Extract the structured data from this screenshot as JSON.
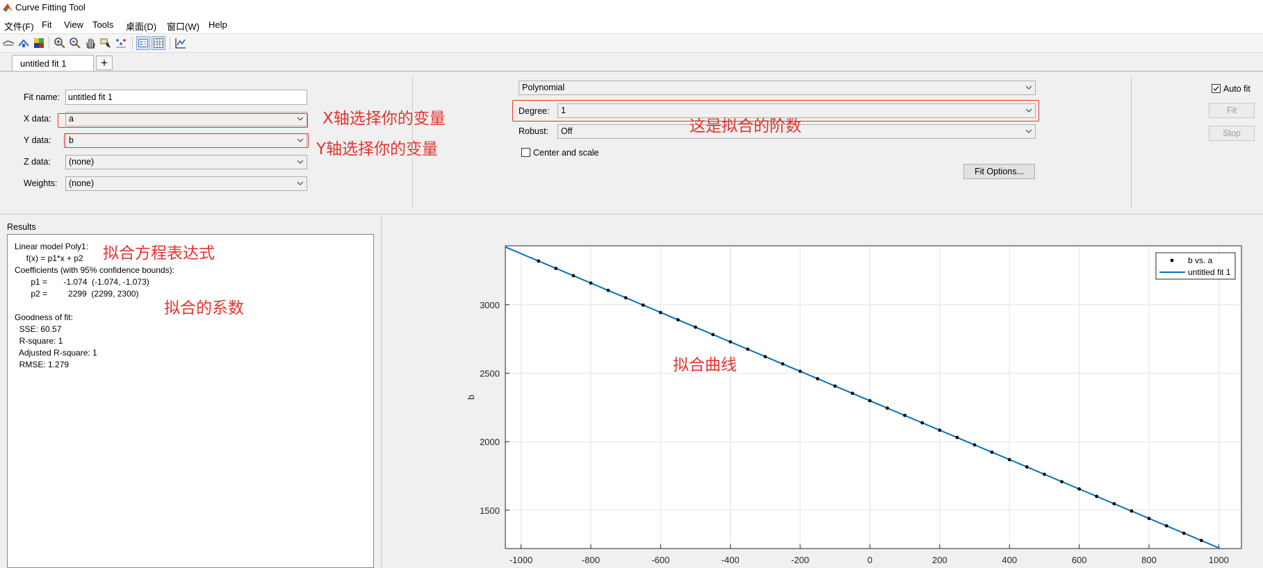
{
  "window": {
    "title": "Curve Fitting Tool"
  },
  "menu": [
    "文件(F)",
    "Fit",
    "View",
    "Tools",
    "桌面(D)",
    "窗口(W)",
    "Help"
  ],
  "tabs": {
    "active": "untitled fit 1",
    "add": "+"
  },
  "form": {
    "fit_name_label": "Fit name:",
    "fit_name_value": "untitled fit 1",
    "x_label": "X data:",
    "x_value": "a",
    "y_label": "Y data:",
    "y_value": "b",
    "z_label": "Z data:",
    "z_value": "(none)",
    "w_label": "Weights:",
    "w_value": "(none)"
  },
  "model": {
    "type": "Polynomial",
    "degree_label": "Degree:",
    "degree_value": "1",
    "robust_label": "Robust:",
    "robust_value": "Off",
    "center_scale_label": "Center and scale",
    "fit_options": "Fit Options..."
  },
  "controls": {
    "auto_fit": "Auto fit",
    "fit": "Fit",
    "stop": "Stop"
  },
  "results": {
    "title": "Results",
    "lines": [
      "Linear model Poly1:",
      "     f(x) = p1*x + p2",
      "Coefficients (with 95% confidence bounds):",
      "       p1 =       -1.074  (-1.074, -1.073)",
      "       p2 =         2299  (2299, 2300)",
      "",
      "Goodness of fit:",
      "  SSE: 60.57",
      "  R-square: 1",
      "  Adjusted R-square: 1",
      "  RMSE: 1.279"
    ]
  },
  "annotations": {
    "x_note": "X轴选择你的变量",
    "y_note": "Y轴选择你的变量",
    "degree_note": "这是拟合的阶数",
    "equation_note": "拟合方程表达式",
    "coeff_note": "拟合的系数",
    "curve_note": "拟合曲线"
  },
  "colors": {
    "annotation": "#e8312f",
    "fit_line": "#0072bd",
    "points": "#000000"
  },
  "chart_data": {
    "type": "scatter",
    "ylabel": "b",
    "xlabel": "",
    "xlim": [
      -1045,
      1065
    ],
    "ylim": [
      1220,
      3430
    ],
    "xticks": [
      -1000,
      -800,
      -600,
      -400,
      -200,
      0,
      200,
      400,
      600,
      800,
      1000
    ],
    "yticks": [
      1500,
      2000,
      2500,
      3000
    ],
    "grid": true,
    "legend_position": "top-right",
    "series": [
      {
        "name": "b vs. a",
        "kind": "points",
        "x": [
          -950,
          -900,
          -850,
          -800,
          -750,
          -700,
          -650,
          -600,
          -550,
          -500,
          -450,
          -400,
          -350,
          -300,
          -250,
          -200,
          -150,
          -100,
          -50,
          0,
          50,
          100,
          150,
          200,
          250,
          300,
          350,
          400,
          450,
          500,
          550,
          600,
          650,
          700,
          750,
          800,
          850,
          900,
          950
        ],
        "y": [
          3319,
          3265,
          3212,
          3158,
          3105,
          3051,
          2997,
          2943,
          2890,
          2836,
          2782,
          2729,
          2675,
          2621,
          2568,
          2514,
          2460,
          2406,
          2353,
          2299,
          2245,
          2192,
          2138,
          2084,
          2031,
          1977,
          1923,
          1869,
          1816,
          1762,
          1708,
          1655,
          1601,
          1547,
          1494,
          1440,
          1386,
          1332,
          1279
        ]
      },
      {
        "name": "untitled fit 1",
        "kind": "line",
        "p1": -1.074,
        "p2": 2299
      }
    ]
  }
}
